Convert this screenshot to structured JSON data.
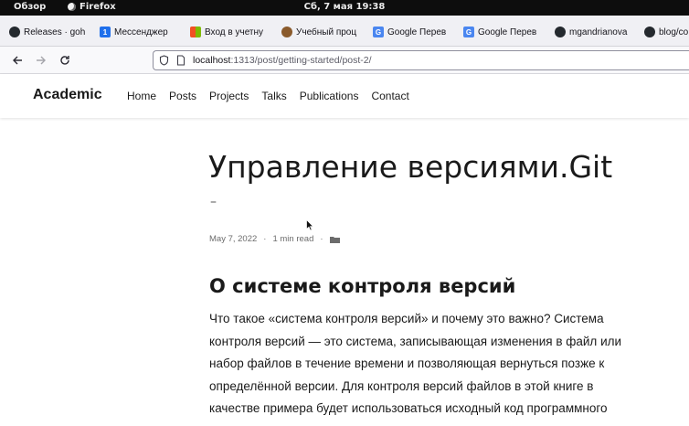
{
  "topbar": {
    "overview": "Обзор",
    "app": "Firefox",
    "clock": "Сб, 7 мая  19:38"
  },
  "tabs": [
    {
      "label": "Releases · goh",
      "icon": "github-icon"
    },
    {
      "label": "Мессенджер",
      "icon": "messenger-icon"
    },
    {
      "label": "Вход в учетну",
      "icon": "microsoft-icon"
    },
    {
      "label": "Учебный проц",
      "icon": "education-icon"
    },
    {
      "label": "Google Перев",
      "icon": "google-translate-icon"
    },
    {
      "label": "Google Перев",
      "icon": "google-translate-icon"
    },
    {
      "label": "mgandrianova",
      "icon": "github-icon"
    },
    {
      "label": "blog/co",
      "icon": "github-icon"
    }
  ],
  "navbar": {
    "url_host": "localhost",
    "url_rest": ":1313/post/getting-started/post-2/"
  },
  "site": {
    "brand": "Academic",
    "menu": [
      "Home",
      "Posts",
      "Projects",
      "Talks",
      "Publications",
      "Contact"
    ]
  },
  "article": {
    "title": "Управление версиями.Git",
    "subtitle": "–",
    "date": "May 7, 2022",
    "read_time": "1 min read",
    "separator": "·",
    "section_heading": "О системе контроля версий",
    "paragraph_lines": [
      "Что такое «система контроля версий» и почему это важно? Система",
      "контроля версий — это система, записывающая изменения в файл или",
      "набор файлов в течение времени и позволяющая вернуться позже к",
      "определённой версии. Для контроля версий файлов в этой книге в",
      "качестве примера будет использоваться исходный код программного"
    ]
  }
}
